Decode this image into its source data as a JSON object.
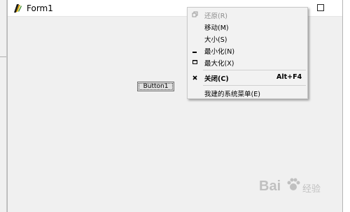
{
  "window": {
    "title": "Form1",
    "icon": "delphi-app-icon",
    "maximize_icon": "maximize-icon"
  },
  "form": {
    "button_label": "Button1"
  },
  "system_menu": {
    "items": [
      {
        "label": "还原(R)",
        "icon": "restore-icon",
        "enabled": false
      },
      {
        "label": "移动(M)",
        "enabled": true
      },
      {
        "label": "大小(S)",
        "enabled": true
      },
      {
        "label": "最小化(N)",
        "icon": "minimize-icon",
        "enabled": true
      },
      {
        "label": "最大化(X)",
        "icon": "maximize-icon",
        "enabled": true
      },
      {
        "label": "关闭(C)",
        "icon": "close-icon",
        "accelerator": "Alt+F4",
        "bold": true,
        "enabled": true
      },
      {
        "label": "我建的系统菜单(E)",
        "enabled": true
      }
    ]
  },
  "watermark": {
    "text": "Bai",
    "suffix": "经验",
    "logo_icon": "paw-icon"
  },
  "colors": {
    "window_bg": "#f0f0f0",
    "menu_bg": "#f2f2f2",
    "disabled_text": "#8c8c8c"
  }
}
